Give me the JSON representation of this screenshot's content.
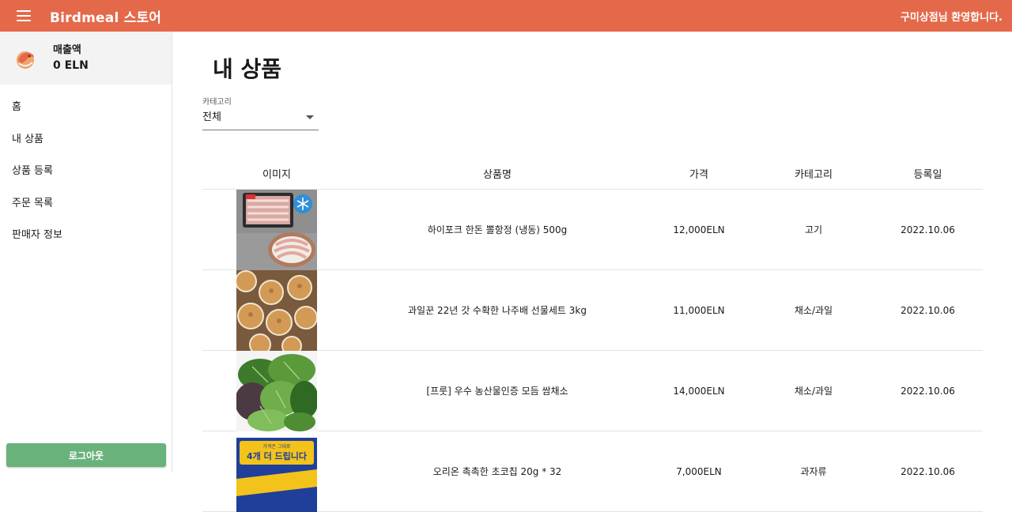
{
  "header": {
    "brand": "Birdmeal 스토어",
    "welcome": "구미상점님 환영합니다."
  },
  "sidebar": {
    "sales_label": "매출액",
    "sales_value": "0 ELN",
    "items": [
      {
        "label": "홈"
      },
      {
        "label": "내 상품"
      },
      {
        "label": "상품 등록"
      },
      {
        "label": "주문 목록"
      },
      {
        "label": "판매자 정보"
      }
    ],
    "logout": "로그아웃"
  },
  "main": {
    "title": "내 상품",
    "category_label": "카테고리",
    "category_value": "전체",
    "columns": [
      "이미지",
      "상품명",
      "가격",
      "카테고리",
      "등록일"
    ],
    "rows": [
      {
        "name": "하이포크 한돈 뽈항정 (냉동) 500g",
        "price": "12,000ELN",
        "category": "고기",
        "date": "2022.10.06",
        "image": "pork-package",
        "badge": "냉동"
      },
      {
        "name": "과일꾼 22년 갓 수확한 나주배 선물세트 3kg",
        "price": "11,000ELN",
        "category": "채소/과일",
        "date": "2022.10.06",
        "image": "pears-box"
      },
      {
        "name": "[프룻] 우수 농산물인증 모듬 쌈채소",
        "price": "14,000ELN",
        "category": "채소/과일",
        "date": "2022.10.06",
        "image": "leafy-greens"
      },
      {
        "name": "오리온 촉촉한 초코칩 20g * 32",
        "price": "7,000ELN",
        "category": "과자류",
        "date": "2022.10.06",
        "image": "snack-box",
        "badge": "가격은 그대로 4개 더 드립니다"
      }
    ]
  },
  "colors": {
    "header": "#e4694a",
    "logout": "#6ab27c",
    "sales_box": "#f3f3f3"
  }
}
